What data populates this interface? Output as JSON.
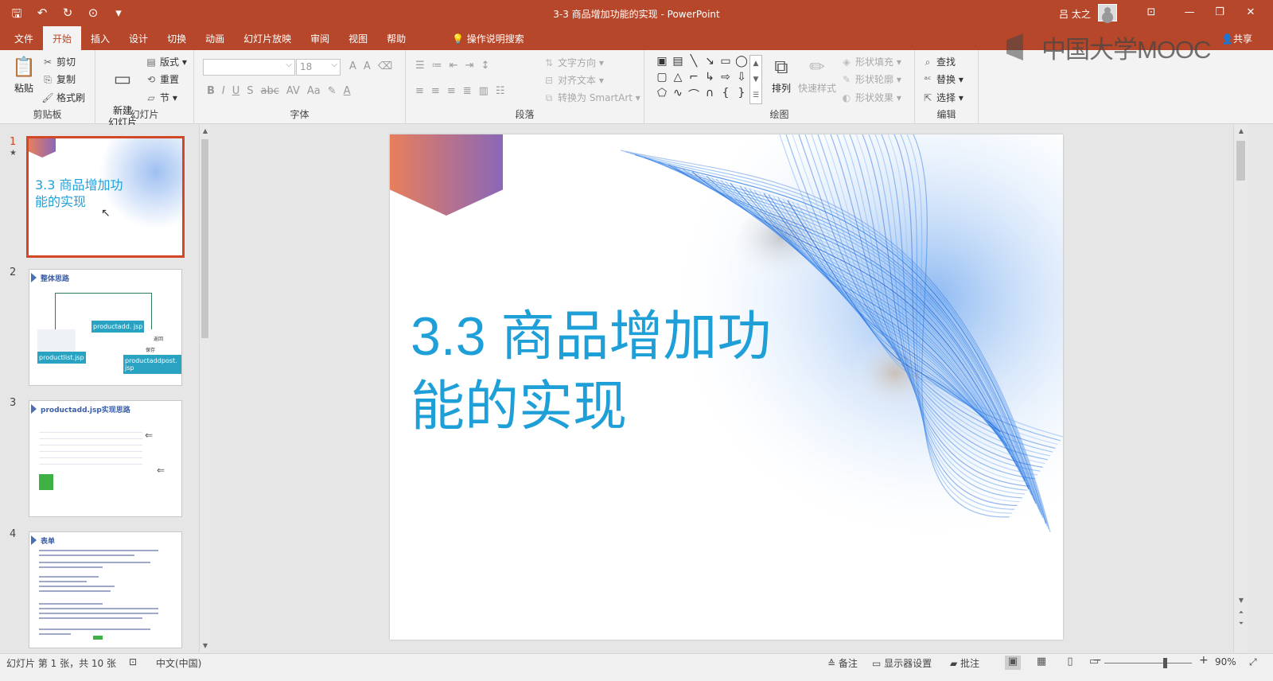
{
  "window": {
    "title": "3-3 商品增加功能的实现  -  PowerPoint",
    "user": "吕 太之",
    "share": "共享"
  },
  "qat": {
    "save_glyph": "🖫",
    "undo_glyph": "↶",
    "redo_glyph": "↻",
    "present_glyph": "⊙",
    "more_glyph": "▾"
  },
  "wctl": {
    "ribbon_opts": "⊡",
    "minimize": "—",
    "restore": "❐",
    "close": "✕"
  },
  "tabs": [
    "文件",
    "开始",
    "插入",
    "设计",
    "切换",
    "动画",
    "幻灯片放映",
    "审阅",
    "视图",
    "帮助"
  ],
  "active_tab": "开始",
  "tellme": "操作说明搜索",
  "watermark": "中国大学MOOC",
  "ribbon": {
    "clipboard": {
      "paste": "粘贴",
      "cut": "剪切",
      "copy": "复制",
      "format_painter": "格式刷",
      "label": "剪贴板"
    },
    "slides": {
      "new_slide": "新建\n幻灯片",
      "layout": "版式",
      "reset": "重置",
      "section": "节",
      "label": "幻灯片"
    },
    "font": {
      "font_name": "",
      "font_size": "18",
      "bold": "B",
      "italic": "I",
      "underline": "U",
      "shadow": "S",
      "strike": "abc",
      "spacing": "AV",
      "case": "Aa",
      "clear": "A",
      "color": "A",
      "grow": "A",
      "shrink": "A",
      "label": "字体"
    },
    "paragraph": {
      "text_direction": "文字方向",
      "align_text": "对齐文本",
      "smartart": "转换为 SmartArt",
      "label": "段落"
    },
    "drawing": {
      "arrange": "排列",
      "quick_styles": "快速样式",
      "fill": "形状填充",
      "outline": "形状轮廓",
      "effects": "形状效果",
      "label": "绘图"
    },
    "editing": {
      "find": "查找",
      "replace": "替换",
      "select": "选择",
      "label": "编辑"
    }
  },
  "slides": [
    {
      "number": "1",
      "title": "3.3 商品增加功\n能的实现",
      "selected": true,
      "star": "★"
    },
    {
      "number": "2",
      "heading": "整体思路",
      "boxes": [
        "productadd. jsp",
        "productlist.jsp",
        "productaddpost. jsp"
      ],
      "small_labels": [
        "保存",
        "返回"
      ]
    },
    {
      "number": "3",
      "heading": "productadd.jsp实现思路"
    },
    {
      "number": "4",
      "heading": "表单"
    }
  ],
  "main_slide": {
    "title": "3.3 商品增加功能的实现",
    "title_line1": "3.3 商品增加功",
    "title_line2": "能的实现",
    "title_color": "#1f9fd8"
  },
  "status": {
    "slide_info": "幻灯片 第 1 张，共 10 张",
    "language": "中文(中国)",
    "notes": "备注",
    "display": "显示器设置",
    "comments": "批注",
    "zoom": "90%",
    "zoom_minus": "−",
    "zoom_plus": "+",
    "zoom_fraction": 0.62
  },
  "colors": {
    "accent": "#b7472a",
    "selection": "#d24726",
    "title": "#1f9fd8"
  }
}
